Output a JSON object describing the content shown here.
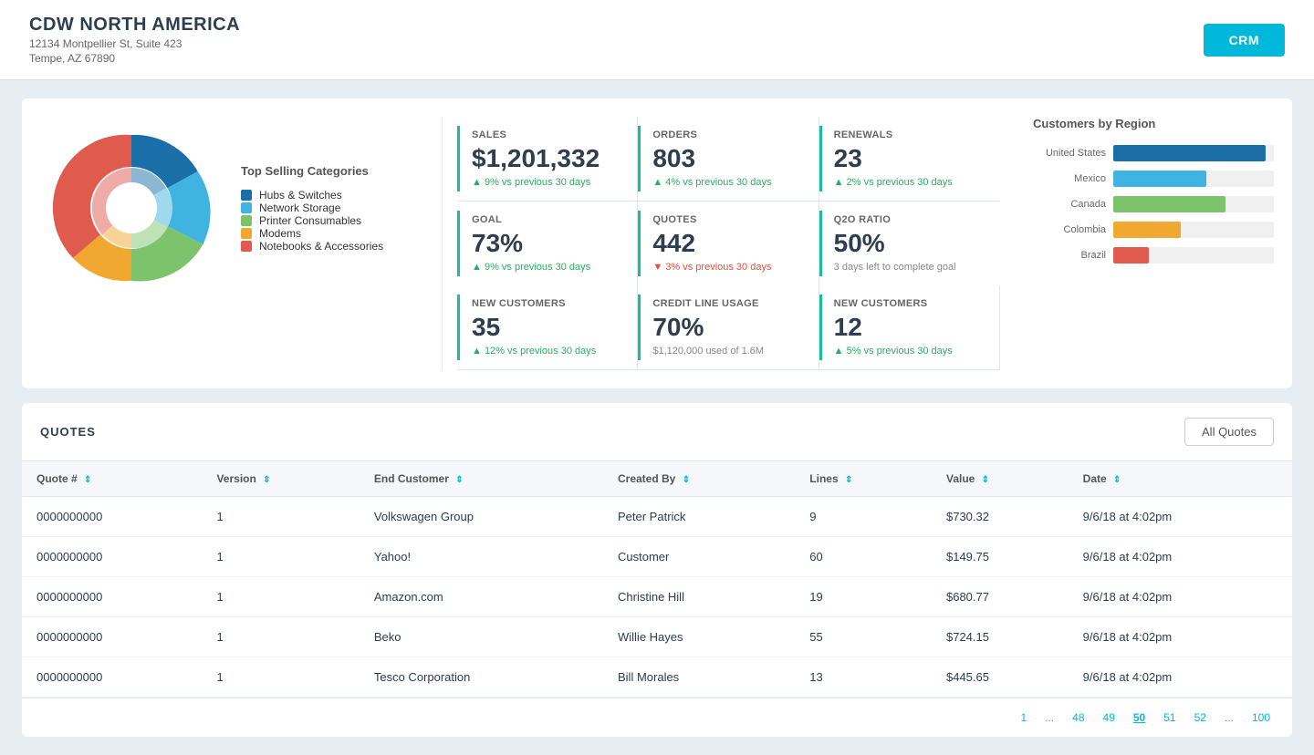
{
  "header": {
    "company": "CDW NORTH AMERICA",
    "address_line1": "12134 Montpellier St, Suite 423",
    "address_line2": "Tempe, AZ 67890",
    "crm_button": "CRM"
  },
  "pie_chart": {
    "title": "Top Selling Categories",
    "segments": [
      {
        "label": "Hubs & Switches",
        "color": "#1a6fa8",
        "percent": 22
      },
      {
        "label": "Network Storage",
        "color": "#40b4e0",
        "percent": 18
      },
      {
        "label": "Printer Consumables",
        "color": "#7dc36b",
        "percent": 20
      },
      {
        "label": "Modems",
        "color": "#f0a830",
        "percent": 15
      },
      {
        "label": "Notebooks & Accessories",
        "color": "#e05a4e",
        "percent": 25
      }
    ]
  },
  "metrics": [
    {
      "label": "Sales",
      "value": "$1,201,332",
      "sub": "9% vs previous 30 days",
      "direction": "up"
    },
    {
      "label": "Orders",
      "value": "803",
      "sub": "4% vs previous 30 days",
      "direction": "up"
    },
    {
      "label": "Renewals",
      "value": "23",
      "sub": "2% vs previous 30 days",
      "direction": "up"
    },
    {
      "label": "Goal",
      "value": "73%",
      "sub": "9% vs previous 30 days",
      "direction": "up"
    },
    {
      "label": "Quotes",
      "value": "442",
      "sub": "3% vs previous 30 days",
      "direction": "down"
    },
    {
      "label": "Q2O Ratio",
      "value": "50%",
      "sub": "3 days left to complete goal",
      "direction": "none"
    },
    {
      "label": "New Customers",
      "value": "35",
      "sub": "12% vs previous 30 days",
      "direction": "up"
    },
    {
      "label": "Credit Line Usage",
      "value": "70%",
      "sub": "$1,120,000 used of 1.6M",
      "direction": "none"
    },
    {
      "label": "New Customers",
      "value": "12",
      "sub": "5% vs previous 30 days",
      "direction": "up"
    }
  ],
  "regions": {
    "title": "Customers by Region",
    "items": [
      {
        "label": "United States",
        "color": "#1a6fa8",
        "width": 95
      },
      {
        "label": "Mexico",
        "color": "#40b4e0",
        "width": 58
      },
      {
        "label": "Canada",
        "color": "#7dc36b",
        "width": 70
      },
      {
        "label": "Colombia",
        "color": "#f0a830",
        "width": 42
      },
      {
        "label": "Brazil",
        "color": "#e05a4e",
        "width": 22
      }
    ]
  },
  "quotes": {
    "title": "QUOTES",
    "all_quotes_label": "All Quotes",
    "columns": [
      "Quote #",
      "Version",
      "End Customer",
      "Created By",
      "Lines",
      "Value",
      "Date"
    ],
    "rows": [
      {
        "quote": "0000000000",
        "version": "1",
        "customer": "Volkswagen Group",
        "created_by": "Peter Patrick",
        "lines": "9",
        "value": "$730.32",
        "date": "9/6/18 at 4:02pm"
      },
      {
        "quote": "0000000000",
        "version": "1",
        "customer": "Yahoo!",
        "created_by": "Customer",
        "lines": "60",
        "value": "$149.75",
        "date": "9/6/18 at 4:02pm"
      },
      {
        "quote": "0000000000",
        "version": "1",
        "customer": "Amazon.com",
        "created_by": "Christine Hill",
        "lines": "19",
        "value": "$680.77",
        "date": "9/6/18 at 4:02pm"
      },
      {
        "quote": "0000000000",
        "version": "1",
        "customer": "Beko",
        "created_by": "Willie Hayes",
        "lines": "55",
        "value": "$724.15",
        "date": "9/6/18 at 4:02pm"
      },
      {
        "quote": "0000000000",
        "version": "1",
        "customer": "Tesco Corporation",
        "created_by": "Bill Morales",
        "lines": "13",
        "value": "$445.65",
        "date": "9/6/18 at 4:02pm"
      }
    ]
  },
  "pagination": {
    "items": [
      "1",
      "...",
      "48",
      "49",
      "50",
      "51",
      "52",
      "...",
      "100"
    ]
  }
}
